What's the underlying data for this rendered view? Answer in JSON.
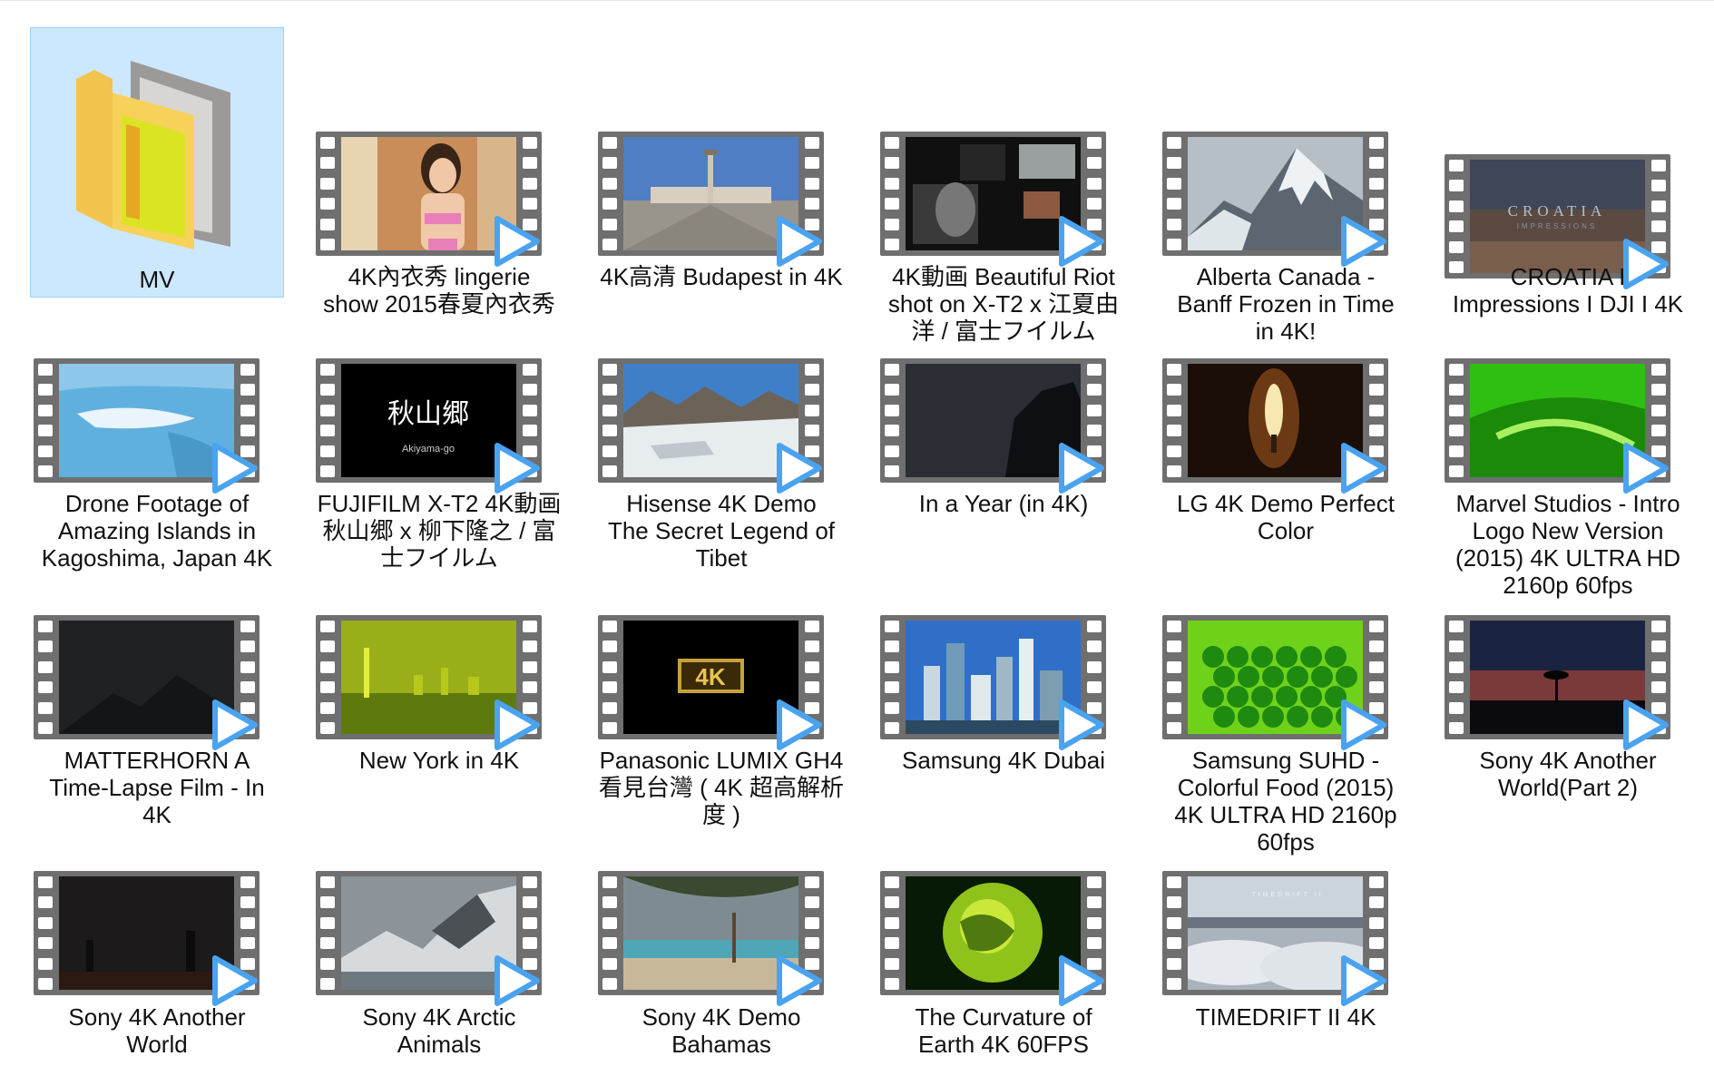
{
  "window": {
    "view": "large-icons"
  },
  "folder": {
    "label": "MV",
    "selected": true
  },
  "videos": [
    {
      "label": "4K內衣秀 lingerie\nshow 2015春夏內衣秀",
      "thumb": "lingerie"
    },
    {
      "label": "4K高清 Budapest in 4K",
      "thumb": "budapest"
    },
    {
      "label": "4K動画  Beautiful Riot\nshot on X-T2  x 江夏由\n洋 / 富士フイルム",
      "thumb": "riot"
    },
    {
      "label": "Alberta Canada -\nBanff Frozen in Time\nin 4K!",
      "thumb": "mountain"
    },
    {
      "label": "CROATIA I\nImpressions I DJI I 4K",
      "thumb": "croatia",
      "overlay": "CROATIA",
      "overlay2": "IMPRESSIONS"
    },
    {
      "label": "Drone Footage of\nAmazing Islands in\nKagoshima, Japan 4K",
      "thumb": "islands"
    },
    {
      "label": "FUJIFILM X-T2 4K動画\n秋山郷  x 柳下隆之 / 富\n士フイルム",
      "thumb": "akiyama",
      "overlay": "秋山郷",
      "overlay2": "Akiyama-go"
    },
    {
      "label": "Hisense 4K Demo\nThe Secret Legend of\nTibet",
      "thumb": "tibet"
    },
    {
      "label": "In a Year (in 4K)",
      "thumb": "night"
    },
    {
      "label": "LG 4K Demo  Perfect\nColor",
      "thumb": "candle"
    },
    {
      "label": "Marvel Studios - Intro\nLogo  New Version\n(2015) 4K ULTRA HD\n2160p 60fps",
      "thumb": "green"
    },
    {
      "label": "MATTERHORN   A\nTime-Lapse Film - In\n4K",
      "thumb": "dark"
    },
    {
      "label": "New York in 4K",
      "thumb": "newyork"
    },
    {
      "label": "Panasonic LUMIX GH4\n看見台灣 ( 4K 超高解析\n度 )",
      "thumb": "panasonic",
      "overlay": "4K"
    },
    {
      "label": "Samsung 4K Dubai",
      "thumb": "dubai"
    },
    {
      "label": "Samsung SUHD -\nColorful Food (2015)\n4K ULTRA HD 2160p\n60fps",
      "thumb": "peas"
    },
    {
      "label": "Sony 4K Another\nWorld(Part 2)",
      "thumb": "sunset"
    },
    {
      "label": "Sony 4K Another\nWorld",
      "thumb": "baobab"
    },
    {
      "label": "Sony 4K Arctic\nAnimals",
      "thumb": "arctic"
    },
    {
      "label": "Sony 4K Demo\nBahamas",
      "thumb": "beach"
    },
    {
      "label": "The Curvature of\nEarth 4K 60FPS",
      "thumb": "earth"
    },
    {
      "label": "TIMEDRIFT II 4K",
      "thumb": "clouds",
      "overlay": "TIMEDRIFT II"
    }
  ],
  "colors": {
    "selection_bg": "#cce8ff",
    "selection_border": "#99d1ff",
    "play": "#4aa3f0"
  }
}
